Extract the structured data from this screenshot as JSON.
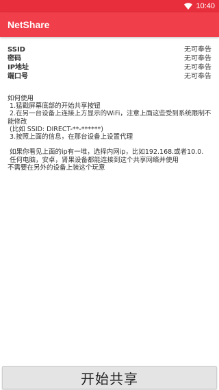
{
  "status_bar": {
    "time": "10:40",
    "wifi_icon": "wifi-icon",
    "color": "#e82e3c"
  },
  "app_bar": {
    "title": "NetShare",
    "color": "#f03e4a"
  },
  "info": [
    {
      "label": "SSID",
      "value": "无可奉告"
    },
    {
      "label": "密码",
      "value": "无可奉告"
    },
    {
      "label": "IP地址",
      "value": "无可奉告"
    },
    {
      "label": "端口号",
      "value": "无可奉告"
    }
  ],
  "instructions": {
    "text": "如何使用\n 1.猛戳屏幕底部的开始共享按钮\n 2.在另一台设备上连接上方显示的WiFi，注意上面这些受到系统限制不能修改\n (比如 SSID: DIRECT-**-******)\n 3.按照上面的信息，在那台设备上设置代理\n\n 如果你看见上面的ip有一堆，选择内网ip，比如192.168.或者10.0.\n 任何电脑，安卓，肾果设备都能连接到这个共享网络并使用\n不需要在另外的设备上装这个玩意"
  },
  "start_button": {
    "label": "开始共享"
  }
}
